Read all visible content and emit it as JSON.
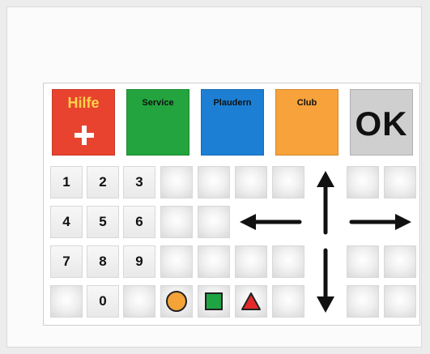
{
  "top_buttons": {
    "help": {
      "label": "Hilfe",
      "color": "#e8432f",
      "icon": "plus-icon"
    },
    "service": {
      "label": "Service",
      "color": "#23a43e"
    },
    "chat": {
      "label": "Plaudern",
      "color": "#1c7fd4"
    },
    "club": {
      "label": "Club",
      "color": "#f7a23a"
    },
    "ok": {
      "label": "OK",
      "color": "#cfcfcf"
    }
  },
  "keypad": {
    "digits": [
      "1",
      "2",
      "3",
      "4",
      "5",
      "6",
      "7",
      "8",
      "9",
      "0"
    ]
  },
  "shapes": {
    "circle": {
      "color": "#f4a339",
      "icon": "circle-icon"
    },
    "square": {
      "color": "#1ea443",
      "icon": "square-icon"
    },
    "triangle": {
      "color": "#e22a2a",
      "icon": "triangle-icon"
    }
  },
  "arrows": {
    "up": "arrow-up-icon",
    "down": "arrow-down-icon",
    "left": "arrow-left-icon",
    "right": "arrow-right-icon"
  }
}
